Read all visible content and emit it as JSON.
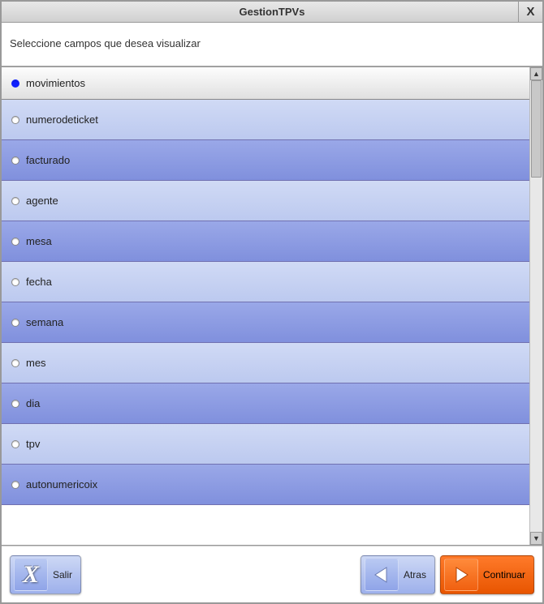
{
  "window": {
    "title": "GestionTPVs"
  },
  "instruction": "Seleccione campos que desea visualizar",
  "fields": [
    {
      "label": "movimientos",
      "selected": true,
      "style": "header"
    },
    {
      "label": "numerodeticket",
      "selected": false,
      "style": "light"
    },
    {
      "label": "facturado",
      "selected": false,
      "style": "dark"
    },
    {
      "label": "agente",
      "selected": false,
      "style": "light"
    },
    {
      "label": "mesa",
      "selected": false,
      "style": "dark"
    },
    {
      "label": "fecha",
      "selected": false,
      "style": "light"
    },
    {
      "label": "semana",
      "selected": false,
      "style": "dark"
    },
    {
      "label": "mes",
      "selected": false,
      "style": "light"
    },
    {
      "label": "dia",
      "selected": false,
      "style": "dark"
    },
    {
      "label": "tpv",
      "selected": false,
      "style": "light"
    },
    {
      "label": "autonumericoix",
      "selected": false,
      "style": "dark"
    }
  ],
  "buttons": {
    "exit": "Salir",
    "back": "Atras",
    "continue": "Continuar"
  }
}
